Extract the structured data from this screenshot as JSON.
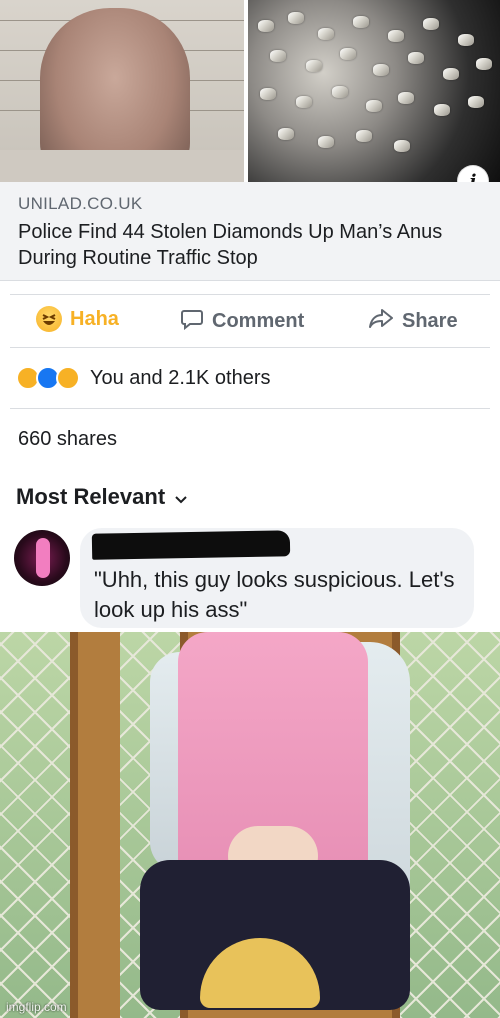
{
  "post": {
    "link_domain": "UNILAD.CO.UK",
    "link_title": "Police Find 44 Stolen Diamonds Up Man’s Anus During Routine Traffic Stop"
  },
  "actions": {
    "haha_label": "Haha",
    "comment_label": "Comment",
    "share_label": "Share"
  },
  "reactions": {
    "summary": "You and 2.1K others",
    "icons": [
      "haha-icon",
      "like-icon",
      "wow-icon"
    ]
  },
  "shares": {
    "text": "660 shares"
  },
  "comments": {
    "sort_label": "Most Relevant",
    "first": {
      "text": "\"Uhh, this guy looks suspicious. Let's look up his ass\""
    }
  },
  "watermark": "imgflip.com",
  "colors": {
    "haha": "#f7b125",
    "muted_text": "#606770",
    "body_text": "#1c1e21",
    "link_preview_bg": "#f2f3f5",
    "bubble_bg": "#f0f2f5",
    "like_blue": "#1877f2"
  }
}
